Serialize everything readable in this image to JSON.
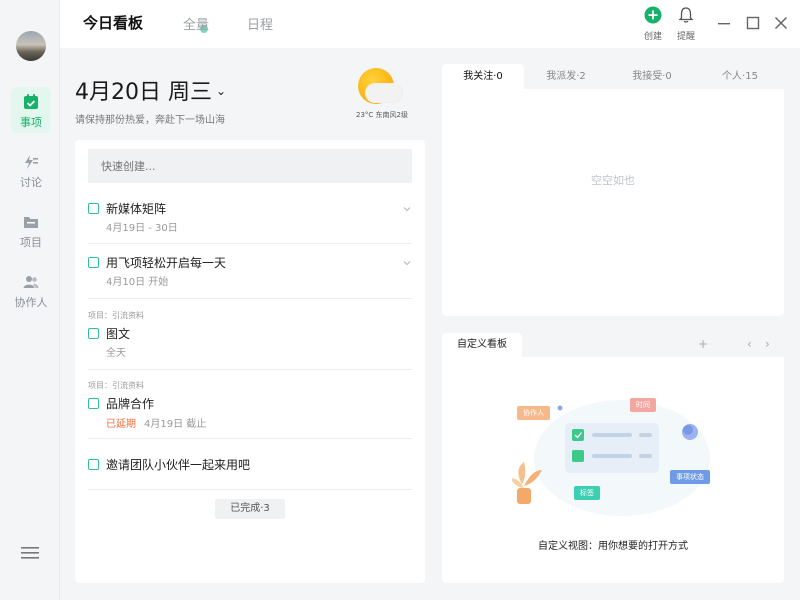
{
  "topbar": {
    "tabs": [
      "今日看板",
      "全量",
      "日程"
    ],
    "create_label": "创建",
    "remind_label": "提醒"
  },
  "sidebar": {
    "items": [
      {
        "label": "事项",
        "icon": "calendar-check-icon"
      },
      {
        "label": "讨论",
        "icon": "discussion-icon"
      },
      {
        "label": "项目",
        "icon": "folder-icon"
      },
      {
        "label": "协作人",
        "icon": "people-icon"
      }
    ]
  },
  "today": {
    "date": "4月20日 周三",
    "motto": "请保持那份热爱，奔赴下一场山海",
    "weather": "23°C 东南风2级"
  },
  "quick_create": {
    "placeholder": "快速创建..."
  },
  "tasks": [
    {
      "project": "",
      "title": "新媒体矩阵",
      "sub": "4月19日 - 30日",
      "overdue": ""
    },
    {
      "project": "",
      "title": "用飞项轻松开启每一天",
      "sub": "4月10日 开始",
      "overdue": ""
    },
    {
      "project": "项目：引流资料",
      "title": "图文",
      "sub": "全天",
      "overdue": ""
    },
    {
      "project": "项目：引流资料",
      "title": "品牌合作",
      "sub": "4月19日 截止",
      "overdue": "已延期"
    },
    {
      "project": "",
      "title": "邀请团队小伙伴一起来用吧",
      "sub": "",
      "overdue": ""
    }
  ],
  "done_label": "已完成·3",
  "follow_panel": {
    "tabs": [
      "我关注·0",
      "我派发·2",
      "我接受·0",
      "个人·15"
    ],
    "empty_text": "空空如也"
  },
  "custom_board": {
    "tab_label": "自定义看板",
    "chips": {
      "collaborator": "协作人",
      "time": "时间",
      "status": "事项状态",
      "tag": "标签"
    },
    "caption": "自定义视图：用你想要的打开方式"
  },
  "colors": {
    "accent": "#17b26a",
    "checkbox": "#2fbf9f",
    "overdue": "#f56c3d"
  }
}
